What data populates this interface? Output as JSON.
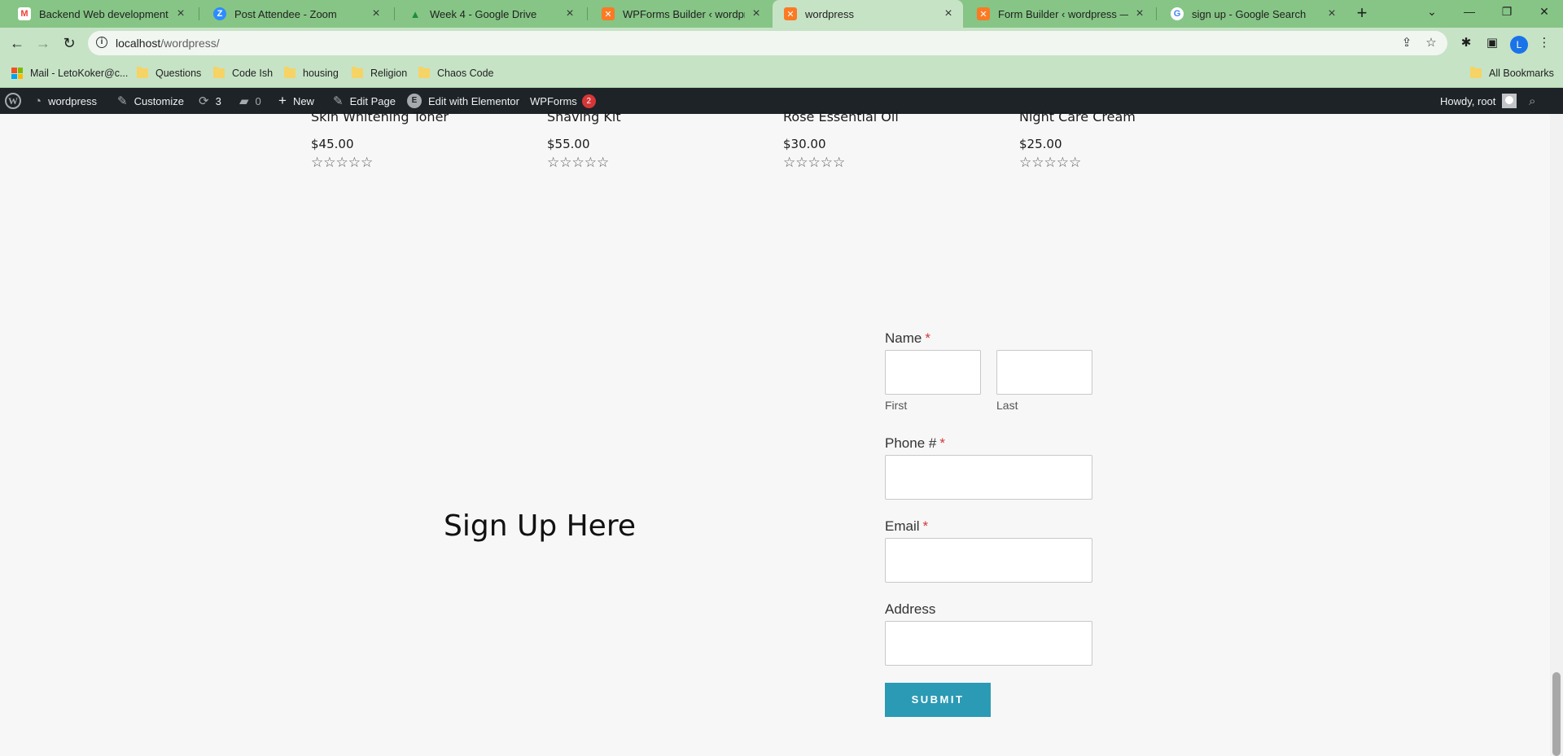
{
  "browser": {
    "tabs": [
      {
        "title": "Backend Web development tra",
        "favicon": "gmail-icon",
        "color": "#ea4335",
        "glyph": "M"
      },
      {
        "title": "Post Attendee - Zoom",
        "favicon": "zoom-icon",
        "color": "#2d8cff",
        "glyph": "Z"
      },
      {
        "title": "Week 4 - Google Drive",
        "favicon": "drive-icon",
        "color": "#fbbc04",
        "glyph": "▲"
      },
      {
        "title": "WPForms Builder ‹ wordpress —",
        "favicon": "xampp-icon",
        "color": "#fb7a24",
        "glyph": "✕"
      },
      {
        "title": "wordpress",
        "favicon": "xampp-icon",
        "color": "#fb7a24",
        "glyph": "✕",
        "active": true
      },
      {
        "title": "Form Builder ‹ wordpress — W",
        "favicon": "xampp-icon",
        "color": "#fb7a24",
        "glyph": "✕"
      },
      {
        "title": "sign up - Google Search",
        "favicon": "google-icon",
        "color": "#4285f4",
        "glyph": "G"
      }
    ],
    "url_host": "localhost",
    "url_path": "/wordpress/",
    "profile_initial": "L",
    "bookmarks": [
      {
        "label": "Mail - LetoKoker@c...",
        "icon": "microsoft-icon"
      },
      {
        "label": "Questions",
        "icon": "folder-icon"
      },
      {
        "label": "Code Ish",
        "icon": "folder-icon"
      },
      {
        "label": "housing",
        "icon": "folder-icon"
      },
      {
        "label": "Religion",
        "icon": "folder-icon"
      },
      {
        "label": "Chaos Code",
        "icon": "folder-icon"
      }
    ],
    "all_bookmarks": "All Bookmarks"
  },
  "adminbar": {
    "site_name": "wordpress",
    "customize": "Customize",
    "updates_count": "3",
    "comments_count": "0",
    "new_label": "New",
    "edit_page": "Edit Page",
    "edit_elementor": "Edit with Elementor",
    "wpforms": "WPForms",
    "wpforms_badge": "2",
    "howdy": "Howdy, root"
  },
  "products": [
    {
      "name": "Skin Whitening Toner",
      "price": "$45.00",
      "stars": "☆☆☆☆☆"
    },
    {
      "name": "Shaving Kit",
      "price": "$55.00",
      "stars": "☆☆☆☆☆"
    },
    {
      "name": "Rose Essential Oil",
      "price": "$30.00",
      "stars": "☆☆☆☆☆"
    },
    {
      "name": "Night Care Cream",
      "price": "$25.00",
      "stars": "☆☆☆☆☆"
    }
  ],
  "signup": {
    "title": "Sign Up Here",
    "name_label": "Name",
    "first_label": "First",
    "last_label": "Last",
    "phone_label": "Phone #",
    "email_label": "Email",
    "address_label": "Address",
    "required_mark": "*",
    "submit_label": "SUBMIT"
  }
}
